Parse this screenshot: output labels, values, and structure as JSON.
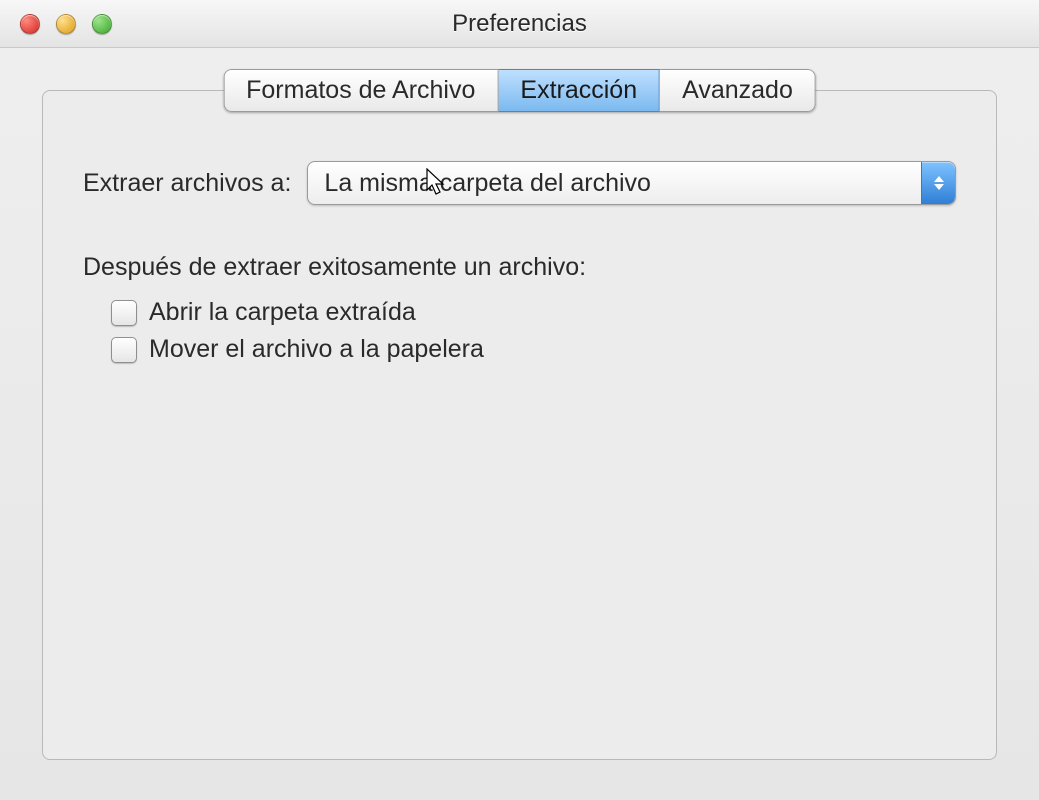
{
  "window": {
    "title": "Preferencias"
  },
  "tabs": {
    "formats": "Formatos de Archivo",
    "extraction": "Extracción",
    "advanced": "Avanzado",
    "active": "extraction"
  },
  "extract": {
    "destination_label": "Extraer archivos a:",
    "destination_value": "La misma carpeta del archivo",
    "after_label": "Después de extraer exitosamente un archivo:",
    "open_folder": "Abrir la carpeta extraída",
    "move_to_trash": "Mover el archivo a la papelera"
  }
}
